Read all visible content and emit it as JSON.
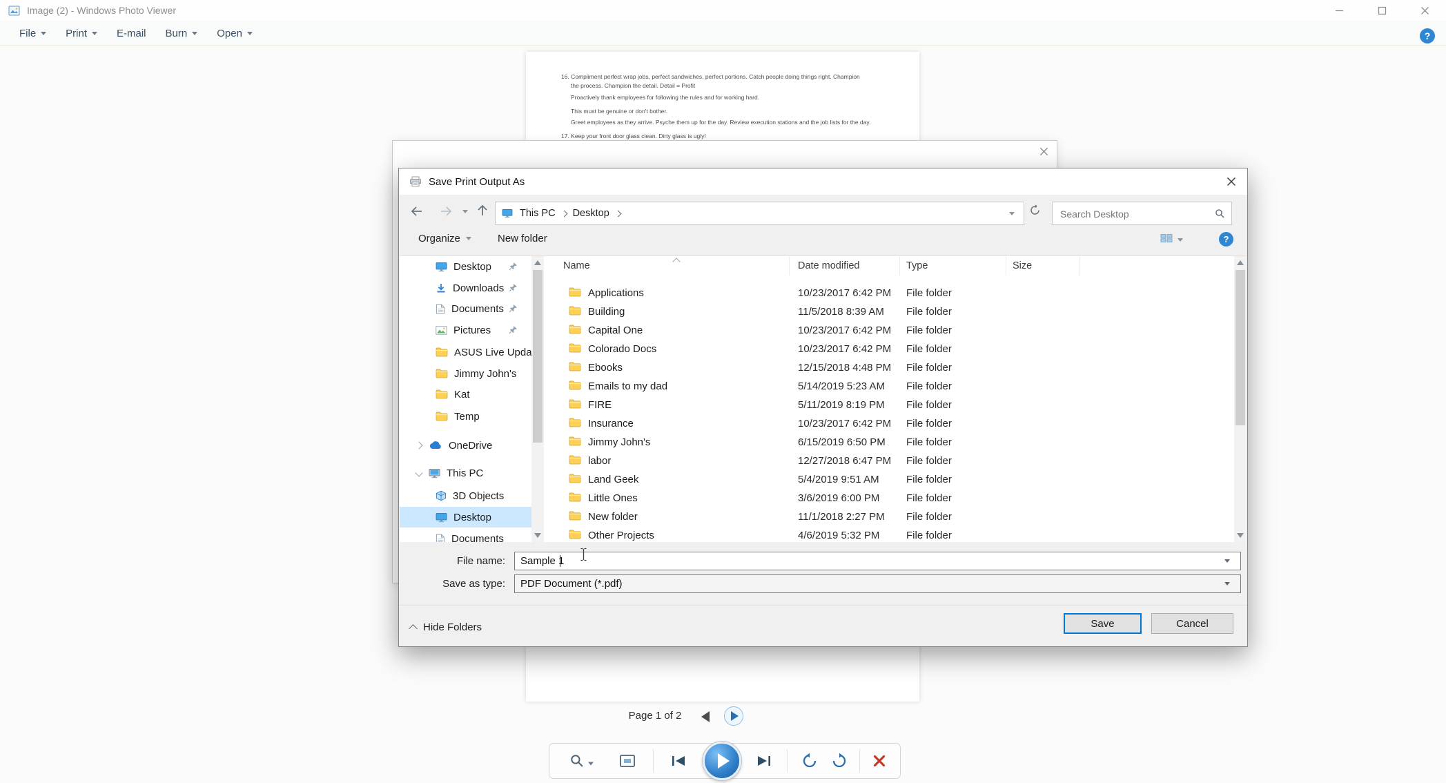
{
  "window": {
    "title": "Image (2) - Windows Photo Viewer",
    "menu": [
      {
        "label": "File",
        "caret": true
      },
      {
        "label": "Print",
        "caret": true
      },
      {
        "label": "E-mail",
        "caret": false
      },
      {
        "label": "Burn",
        "caret": true
      },
      {
        "label": "Open",
        "caret": true
      }
    ],
    "help_label": "?",
    "page_indicator": "Page 1 of 2"
  },
  "preview": {
    "lines": [
      "16.   Compliment perfect wrap jobs, perfect sandwiches, perfect portions. Catch people doing things right. Champion",
      "the process. Champion the detail. Detail = Profit",
      "Proactively thank employees for following the rules and for working hard.",
      "This must be genuine or don't bother.",
      "Greet employees as they arrive. Psyche them up for the day. Review execution stations and the job lists for the day.",
      "17.   Keep your front door glass clean. Dirty glass is ugly!"
    ]
  },
  "dialog": {
    "title": "Save Print Output As",
    "breadcrumb": [
      "This PC",
      "Desktop"
    ],
    "search_placeholder": "Search Desktop",
    "toolbar": {
      "organize": "Organize",
      "new_folder": "New folder",
      "help": "?"
    },
    "sidebar": [
      {
        "label": "Desktop",
        "icon": "desktop",
        "pinned": true
      },
      {
        "label": "Downloads",
        "icon": "downloads",
        "pinned": true
      },
      {
        "label": "Documents",
        "icon": "documents",
        "pinned": true
      },
      {
        "label": "Pictures",
        "icon": "pictures",
        "pinned": true
      },
      {
        "label": "ASUS Live Update",
        "icon": "folder"
      },
      {
        "label": "Jimmy John's",
        "icon": "folder"
      },
      {
        "label": "Kat",
        "icon": "folder"
      },
      {
        "label": "Temp",
        "icon": "folder"
      },
      {
        "label": "OneDrive",
        "icon": "onedrive",
        "chevron": "right"
      },
      {
        "label": "This PC",
        "icon": "pc",
        "chevron": "down"
      },
      {
        "label": "3D Objects",
        "icon": "cube"
      },
      {
        "label": "Desktop",
        "icon": "desktop",
        "selected": true
      },
      {
        "label": "Documents",
        "icon": "documents"
      }
    ],
    "columns": [
      "Name",
      "Date modified",
      "Type",
      "Size"
    ],
    "files": [
      {
        "name": "Applications",
        "date": "10/23/2017 6:42 PM",
        "type": "File folder"
      },
      {
        "name": "Building",
        "date": "11/5/2018 8:39 AM",
        "type": "File folder"
      },
      {
        "name": "Capital One",
        "date": "10/23/2017 6:42 PM",
        "type": "File folder"
      },
      {
        "name": "Colorado Docs",
        "date": "10/23/2017 6:42 PM",
        "type": "File folder"
      },
      {
        "name": "Ebooks",
        "date": "12/15/2018 4:48 PM",
        "type": "File folder"
      },
      {
        "name": "Emails to my dad",
        "date": "5/14/2019 5:23 AM",
        "type": "File folder"
      },
      {
        "name": "FIRE",
        "date": "5/11/2019 8:19 PM",
        "type": "File folder"
      },
      {
        "name": "Insurance",
        "date": "10/23/2017 6:42 PM",
        "type": "File folder"
      },
      {
        "name": "Jimmy John's",
        "date": "6/15/2019 6:50 PM",
        "type": "File folder"
      },
      {
        "name": "labor",
        "date": "12/27/2018 6:47 PM",
        "type": "File folder"
      },
      {
        "name": "Land Geek",
        "date": "5/4/2019 9:51 AM",
        "type": "File folder"
      },
      {
        "name": "Little Ones",
        "date": "3/6/2019 6:00 PM",
        "type": "File folder"
      },
      {
        "name": "New folder",
        "date": "11/1/2018 2:27 PM",
        "type": "File folder"
      },
      {
        "name": "Other Projects",
        "date": "4/6/2019 5:32 PM",
        "type": "File folder"
      }
    ],
    "file_name_label": "File name:",
    "file_name_value": "Sample 1",
    "save_as_type_label": "Save as type:",
    "save_as_type_value": "PDF Document (*.pdf)",
    "hide_folders_label": "Hide Folders",
    "save_label": "Save",
    "cancel_label": "Cancel"
  },
  "colors": {
    "accent_blue": "#0078d7",
    "selection_blue": "#cce8ff",
    "folder_yellow": "#ffd056",
    "play_button_blue": "#2f7ec9",
    "delete_red": "#c23a28",
    "help_blue": "#2f86d2"
  }
}
